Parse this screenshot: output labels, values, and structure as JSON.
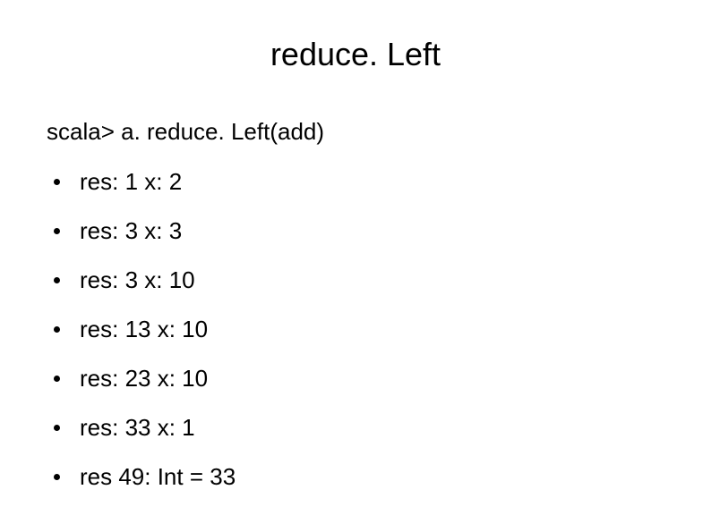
{
  "title": "reduce. Left",
  "prompt": "scala> a. reduce. Left(add)",
  "bullets": [
    "res: 1 x: 2",
    "res: 3 x: 3",
    "res: 3 x: 10",
    "res: 13 x: 10",
    "res: 23 x: 10",
    "res: 33 x: 1",
    "res 49: Int = 33"
  ]
}
